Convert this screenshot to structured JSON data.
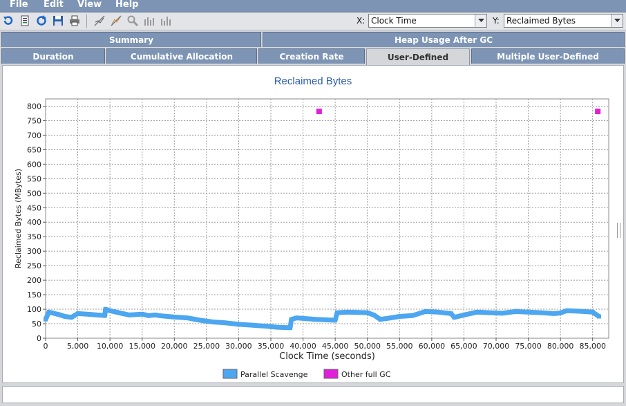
{
  "menu": {
    "file": "File",
    "edit": "Edit",
    "view": "View",
    "help": "Help"
  },
  "toolbar": {
    "icons": [
      "undo-icon",
      "open-doc-icon",
      "refresh-icon",
      "save-icon",
      "print-icon",
      "line-chart-icon",
      "line-chart-alt-icon",
      "zoom-icon",
      "bar-chart-icon",
      "bar-chart-alt-icon"
    ],
    "x_label": "X:",
    "x_value": "Clock Time",
    "y_label": "Y:",
    "y_value": "Reclaimed Bytes"
  },
  "tabs": {
    "row1": [
      "Summary",
      "Heap Usage After GC"
    ],
    "row2": [
      "Duration",
      "Cumulative Allocation",
      "Creation Rate",
      "User-Defined",
      "Multiple User-Defined"
    ],
    "selected": "User-Defined"
  },
  "chart_data": {
    "type": "scatter",
    "title": "Reclaimed Bytes",
    "xlabel": "Clock Time  (seconds)",
    "ylabel": "Reclaimed Bytes  (MBytes)",
    "xlim": [
      0,
      87500
    ],
    "ylim": [
      0,
      825
    ],
    "xticks": [
      "0",
      "5,000",
      "10,000",
      "15,000",
      "20,000",
      "25,000",
      "30,000",
      "35,000",
      "40,000",
      "45,000",
      "50,000",
      "55,000",
      "60,000",
      "65,000",
      "70,000",
      "75,000",
      "80,000",
      "85,000"
    ],
    "yticks": [
      "0",
      "50",
      "100",
      "150",
      "200",
      "250",
      "300",
      "350",
      "400",
      "450",
      "500",
      "550",
      "600",
      "650",
      "700",
      "750",
      "800"
    ],
    "grid": true,
    "legend_position": "bottom",
    "series": [
      {
        "name": "Parallel Scavenge",
        "color": "#4da6f0",
        "x": [
          0,
          500,
          900,
          2000,
          3000,
          4000,
          5000,
          7000,
          9200,
          9300,
          10000,
          11000,
          12000,
          13000,
          15000,
          16000,
          17000,
          18000,
          20000,
          22000,
          24000,
          26000,
          28000,
          30000,
          32000,
          34000,
          36000,
          38000,
          38200,
          39000,
          42000,
          45000,
          45300,
          47000,
          50000,
          51000,
          52000,
          53000,
          55000,
          57000,
          59000,
          61000,
          63000,
          63500,
          65000,
          67000,
          69000,
          71000,
          73000,
          75000,
          77000,
          79000,
          80000,
          81000,
          83000,
          85000,
          86000
        ],
        "y": [
          65,
          90,
          88,
          82,
          75,
          72,
          85,
          82,
          78,
          100,
          95,
          90,
          85,
          80,
          83,
          78,
          80,
          77,
          73,
          70,
          62,
          56,
          53,
          48,
          45,
          42,
          38,
          36,
          65,
          70,
          65,
          62,
          88,
          90,
          88,
          80,
          65,
          68,
          75,
          78,
          92,
          90,
          85,
          72,
          80,
          90,
          88,
          86,
          92,
          90,
          88,
          85,
          87,
          95,
          93,
          90,
          75
        ]
      },
      {
        "name": "Other full GC",
        "color": "#e020d8",
        "x": [
          42500,
          85800
        ],
        "y": [
          782,
          782
        ]
      }
    ]
  }
}
